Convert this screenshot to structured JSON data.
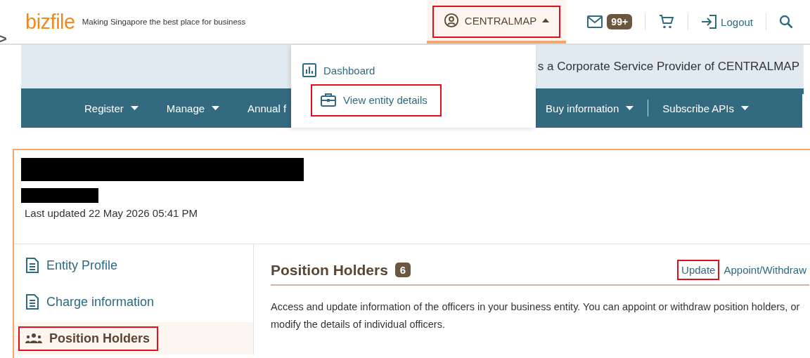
{
  "edge_mark": ">",
  "header": {
    "logo": "bizfile",
    "tagline": "Making Singapore the best place for business",
    "account": {
      "label": "CENTRALMAP",
      "expanded": true,
      "highlighted": true
    },
    "mail_badge": "99+",
    "logout": "Logout"
  },
  "banner": {
    "text": "s a Corporate Service Provider of CENTRALMAP"
  },
  "nav_left": [
    {
      "label": "Register",
      "dropdown": true
    },
    {
      "label": "Manage",
      "dropdown": true
    },
    {
      "label": "Annual f",
      "dropdown": false
    }
  ],
  "nav_right": [
    {
      "label": "Buy information",
      "dropdown": true
    },
    {
      "label": "Subscribe APIs",
      "dropdown": true
    }
  ],
  "account_menu": [
    {
      "label": "Dashboard",
      "kind": "chart",
      "highlighted": false
    },
    {
      "label": "View entity details",
      "kind": "briefcase",
      "highlighted": true
    }
  ],
  "entity": {
    "last_updated": "Last updated 22 May 2026 05:41 PM"
  },
  "sidebar": [
    {
      "label": "Entity Profile",
      "kind": "document",
      "selected": false,
      "highlighted": false
    },
    {
      "label": "Charge information",
      "kind": "document",
      "selected": false,
      "highlighted": false
    },
    {
      "label": "Position Holders",
      "kind": "people",
      "selected": true,
      "highlighted": true
    }
  ],
  "section": {
    "title": "Position Holders",
    "count": "6",
    "actions": [
      {
        "label": "Update",
        "highlighted": true
      },
      {
        "label": "Appoint/Withdraw",
        "highlighted": false
      }
    ],
    "description": "Access and update information of the officers in your business entity. You can appoint or withdraw position holders, or modify the details of individual officers."
  }
}
